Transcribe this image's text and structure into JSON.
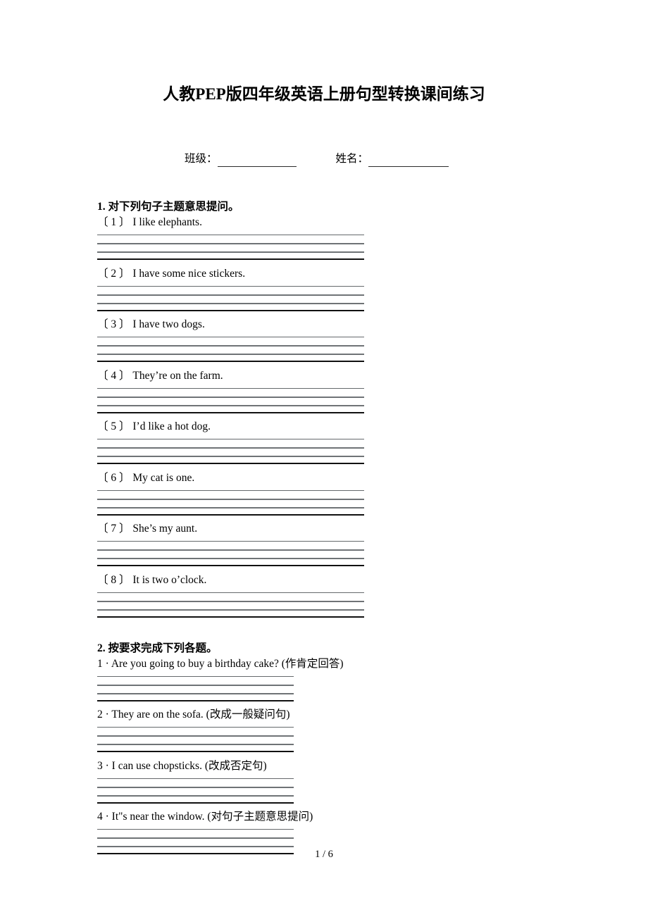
{
  "document": {
    "title": "人教PEP版四年级英语上册句型转换课间练习",
    "page_footer": "1 / 6"
  },
  "student_info": {
    "class_label": "班级：",
    "name_label": "姓名："
  },
  "sections": [
    {
      "heading": "1.  对下列句子主题意思提问。",
      "items": [
        {
          "num": "〔 1 〕",
          "text": "I like elephants."
        },
        {
          "num": "〔 2 〕",
          "text": "I have some nice stickers."
        },
        {
          "num": "〔 3 〕",
          "text": "I have two dogs."
        },
        {
          "num": "〔 4 〕",
          "text": "They’re on the farm."
        },
        {
          "num": "〔 5 〕",
          "text": "I’d like a hot dog."
        },
        {
          "num": "〔 6 〕",
          "text": "My cat is one."
        },
        {
          "num": "〔 7 〕",
          "text": "She’s my aunt."
        },
        {
          "num": "〔 8 〕",
          "text": "It is two o’clock."
        }
      ]
    },
    {
      "heading": "2.  按要求完成下列各题。",
      "items": [
        {
          "num": "1 ·",
          "text": "Are you going to buy a birthday cake? (作肯定回答)"
        },
        {
          "num": "2 ·",
          "text": "They are on the sofa. (改成一般疑问句)"
        },
        {
          "num": "3 ·",
          "text": "I can use chopsticks. (改成否定句)"
        },
        {
          "num": "4 ·",
          "text": "It\"s near the window. (对句子主题意思提问)"
        }
      ]
    }
  ]
}
